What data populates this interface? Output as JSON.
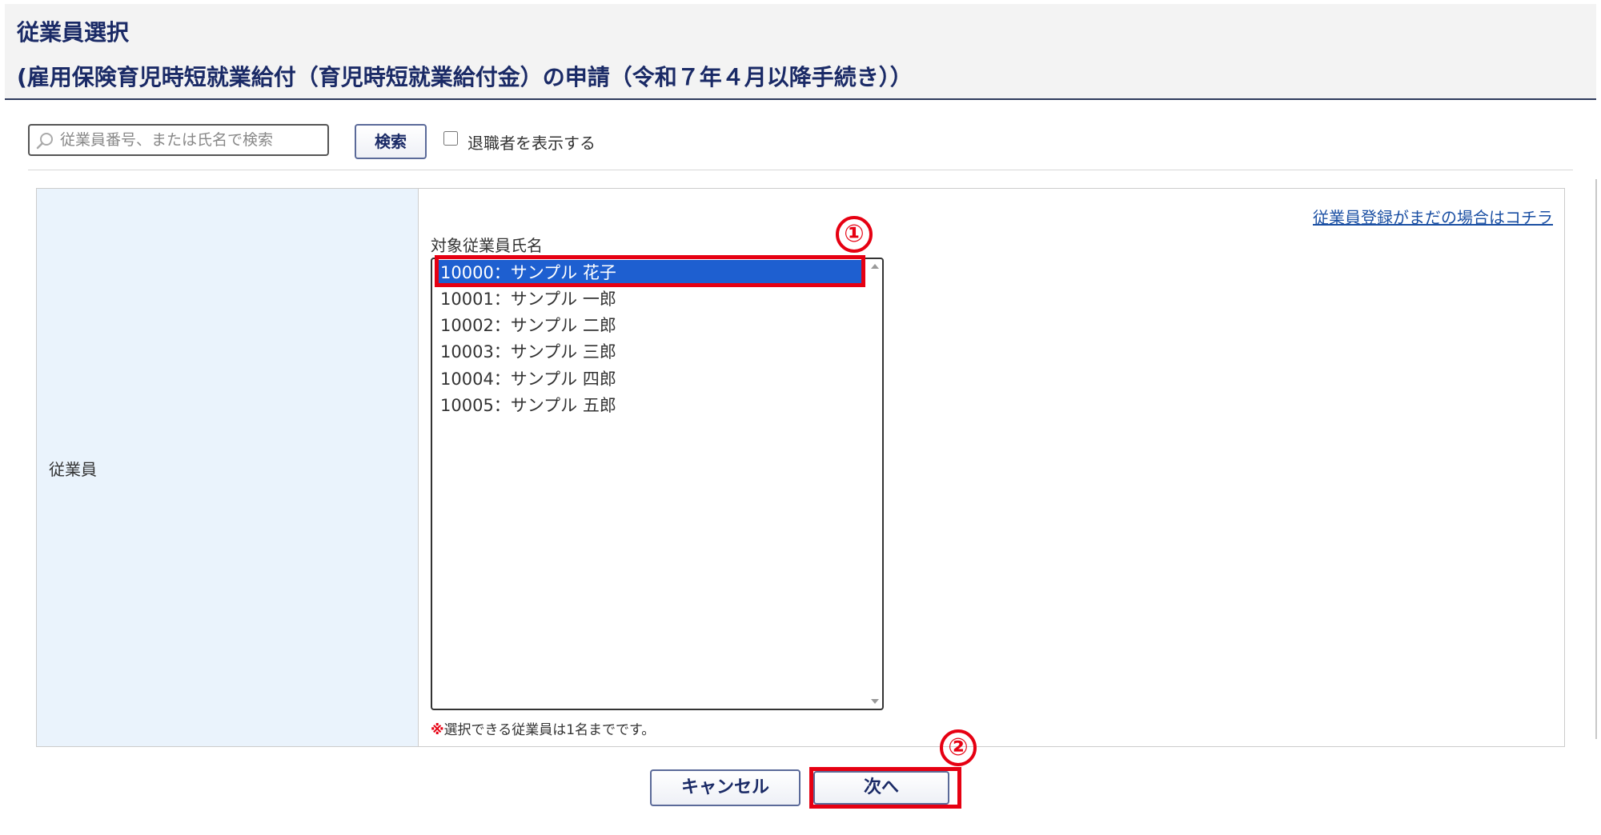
{
  "header": {
    "title": "従業員選択",
    "subtitle": "(雇用保険育児時短就業給付（育児時短就業給付金）の申請（令和７年４月以降手続き））"
  },
  "search": {
    "placeholder": "従業員番号、または氏名で検索",
    "value": "",
    "button_label": "検索",
    "show_retired_label": "退職者を表示する",
    "show_retired_checked": false
  },
  "form": {
    "employee_label": "従業員",
    "register_link": "従業員登録がまだの場合はコチラ",
    "list_label": "対象従業員氏名",
    "employees": [
      {
        "label": "10000：サンプル 花子",
        "selected": true
      },
      {
        "label": "10001：サンプル 一郎",
        "selected": false
      },
      {
        "label": "10002：サンプル 二郎",
        "selected": false
      },
      {
        "label": "10003：サンプル 三郎",
        "selected": false
      },
      {
        "label": "10004：サンプル 四郎",
        "selected": false
      },
      {
        "label": "10005：サンプル 五郎",
        "selected": false
      }
    ],
    "note_mark": "※",
    "note_text": "選択できる従業員は1名までです。"
  },
  "annotations": {
    "step1": "①",
    "step2": "②",
    "highlight_color": "#e60012"
  },
  "footer": {
    "cancel_label": "キャンセル",
    "next_label": "次へ"
  },
  "colors": {
    "title": "#1a2a66",
    "selected_row": "#1e5fd0",
    "label_cell_bg": "#eaf3fc",
    "link": "#1a4fa3"
  }
}
